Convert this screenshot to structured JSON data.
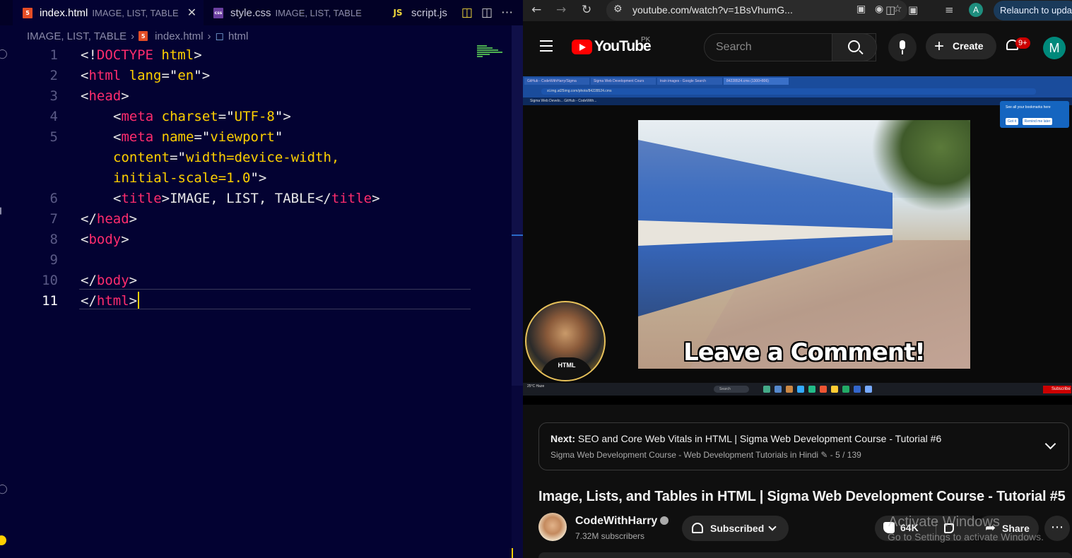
{
  "editor": {
    "tabs": [
      {
        "file": "index.html",
        "desc": "IMAGE, LIST, TABLE",
        "icon": "html5-file-icon",
        "active": true,
        "close": "✕"
      },
      {
        "file": "style.css",
        "desc": "IMAGE, LIST, TABLE",
        "icon": "css-file-icon",
        "active": false
      },
      {
        "file": "script.js",
        "desc": "",
        "icon": "js-file-icon",
        "active": false,
        "icon_text": "JS"
      }
    ],
    "breadcrumb": {
      "folder": "IMAGE, LIST, TABLE",
      "file": "index.html",
      "symbol": "html"
    },
    "current_line": 11,
    "lines": [
      {
        "n": "1",
        "code": "<!DOCTYPE html>"
      },
      {
        "n": "2",
        "code": "<html lang=\"en\">"
      },
      {
        "n": "3",
        "code": "<head>"
      },
      {
        "n": "4",
        "code": "<meta charset=\"UTF-8\">"
      },
      {
        "n": "5",
        "code": "<meta name=\"viewport\""
      },
      {
        "n": "",
        "code": "content=\"width=device-width,"
      },
      {
        "n": "",
        "code": "initial-scale=1.0\">"
      },
      {
        "n": "6",
        "code": "<title>IMAGE, LIST, TABLE</title>"
      },
      {
        "n": "7",
        "code": "</head>"
      },
      {
        "n": "8",
        "code": "<body>"
      },
      {
        "n": "9",
        "code": ""
      },
      {
        "n": "10",
        "code": "</body>"
      },
      {
        "n": "11",
        "code": "</html>"
      }
    ],
    "colors": {
      "tag": "#ff2c6d",
      "attr": "#ffd000",
      "string": "#ffffff",
      "background": "#030232"
    }
  },
  "browser": {
    "url": "youtube.com/watch?v=1BsVhumG...",
    "relaunch_label": "Relaunch to update",
    "profile_initial": "A",
    "nav_icons": [
      "back-icon",
      "forward-icon",
      "reload-icon",
      "site-info-icon",
      "install-app-icon",
      "hide-icon",
      "bookmark-star-icon",
      "split-screen-icon",
      "extensions-icon",
      "media-controls-icon"
    ]
  },
  "youtube": {
    "logo_text": "YouTube",
    "country": "PK",
    "search_placeholder": "Search",
    "create_label": "Create",
    "notifications_badge": "9+",
    "account_initial": "M",
    "video": {
      "overlay_text": "Leave a Comment!",
      "inner_tabs": [
        "GitHub - CodeWithHarry/Sigma",
        "Sigma Web Development Cours",
        "train images - Google Search",
        "84228524.cms (1300×806)"
      ],
      "inner_url": "st.img.at25img.com/photo/84228524.cms",
      "inner_bookmarks": "Sigma Web Develo...   GitHub - CodeWith...",
      "bookmark_popup": {
        "text": "See all your bookmarks here",
        "got_it": "Got it",
        "remind": "Remind me later"
      },
      "taskbar_search": "Search",
      "weather": "25°C Haze",
      "subscribe_badge": "Subscribe",
      "shirt_text": "HTML"
    },
    "next": {
      "label": "Next:",
      "title": "SEO and Core Web Vitals in HTML | Sigma Web Development Course - Tutorial #6",
      "playlist": "Sigma Web Development Course - Web Development Tutorials in Hindi",
      "position": "5 / 139"
    },
    "title": "Image, Lists, and Tables in HTML | Sigma Web Development Course - Tutorial #5",
    "channel": {
      "name": "CodeWithHarry",
      "subscribers": "7.32M subscribers"
    },
    "subscribed_label": "Subscribed",
    "likes": "64K",
    "share_label": "Share",
    "watermark": {
      "line1": "Activate Windows",
      "line2": "Go to Settings to activate Windows."
    }
  }
}
